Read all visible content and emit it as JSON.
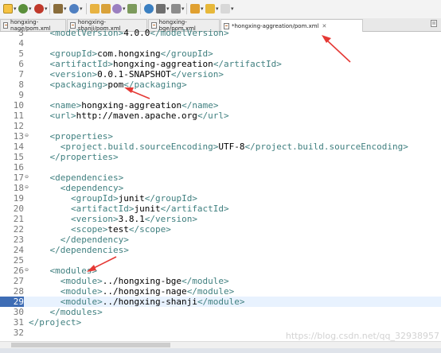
{
  "tabs": [
    {
      "label": "hongxing-nage/pom.xml",
      "close": "",
      "active": false
    },
    {
      "label": "hongxing-shanji/pom.xml",
      "close": "",
      "active": false
    },
    {
      "label": "hongxing-bge/pom.xml",
      "close": "",
      "active": false
    },
    {
      "label": "*hongxing-aggreation/pom.xml",
      "close": "✕",
      "active": true
    }
  ],
  "editor": {
    "current_line": "29",
    "lines": [
      {
        "n": "3",
        "fold": "",
        "parts": [
          {
            "t": "    <modelVersion>",
            "c": "tg"
          },
          {
            "t": "4.0.0",
            "c": "tx"
          },
          {
            "t": "</modelVersion>",
            "c": "tg"
          }
        ]
      },
      {
        "n": "4",
        "fold": "",
        "parts": []
      },
      {
        "n": "5",
        "fold": "",
        "parts": [
          {
            "t": "    <groupId>",
            "c": "tg"
          },
          {
            "t": "com.hongxing",
            "c": "tx"
          },
          {
            "t": "</groupId>",
            "c": "tg"
          }
        ]
      },
      {
        "n": "6",
        "fold": "",
        "parts": [
          {
            "t": "    <artifactId>",
            "c": "tg"
          },
          {
            "t": "hongxing-aggreation",
            "c": "tx"
          },
          {
            "t": "</artifactId>",
            "c": "tg"
          }
        ]
      },
      {
        "n": "7",
        "fold": "",
        "parts": [
          {
            "t": "    <version>",
            "c": "tg"
          },
          {
            "t": "0.0.1-SNAPSHOT",
            "c": "tx"
          },
          {
            "t": "</version>",
            "c": "tg"
          }
        ]
      },
      {
        "n": "8",
        "fold": "",
        "parts": [
          {
            "t": "    <packaging>",
            "c": "tg"
          },
          {
            "t": "pom",
            "c": "tx"
          },
          {
            "t": "</packaging>",
            "c": "tg"
          }
        ]
      },
      {
        "n": "9",
        "fold": "",
        "parts": []
      },
      {
        "n": "10",
        "fold": "",
        "parts": [
          {
            "t": "    <name>",
            "c": "tg"
          },
          {
            "t": "hongxing-aggreation",
            "c": "tx"
          },
          {
            "t": "</name>",
            "c": "tg"
          }
        ]
      },
      {
        "n": "11",
        "fold": "",
        "parts": [
          {
            "t": "    <url>",
            "c": "tg"
          },
          {
            "t": "http://maven.apache.org",
            "c": "tx"
          },
          {
            "t": "</url>",
            "c": "tg"
          }
        ]
      },
      {
        "n": "12",
        "fold": "",
        "parts": []
      },
      {
        "n": "13",
        "fold": "⊖",
        "parts": [
          {
            "t": "    <properties>",
            "c": "tg"
          }
        ]
      },
      {
        "n": "14",
        "fold": "",
        "parts": [
          {
            "t": "      <project.build.sourceEncoding>",
            "c": "tg"
          },
          {
            "t": "UTF-8",
            "c": "tx"
          },
          {
            "t": "</project.build.sourceEncoding>",
            "c": "tg"
          }
        ]
      },
      {
        "n": "15",
        "fold": "",
        "parts": [
          {
            "t": "    </properties>",
            "c": "tg"
          }
        ]
      },
      {
        "n": "16",
        "fold": "",
        "parts": []
      },
      {
        "n": "17",
        "fold": "⊖",
        "parts": [
          {
            "t": "    <dependencies>",
            "c": "tg"
          }
        ]
      },
      {
        "n": "18",
        "fold": "⊖",
        "parts": [
          {
            "t": "      <dependency>",
            "c": "tg"
          }
        ]
      },
      {
        "n": "19",
        "fold": "",
        "parts": [
          {
            "t": "        <groupId>",
            "c": "tg"
          },
          {
            "t": "junit",
            "c": "tx"
          },
          {
            "t": "</groupId>",
            "c": "tg"
          }
        ]
      },
      {
        "n": "20",
        "fold": "",
        "parts": [
          {
            "t": "        <artifactId>",
            "c": "tg"
          },
          {
            "t": "junit",
            "c": "tx"
          },
          {
            "t": "</artifactId>",
            "c": "tg"
          }
        ]
      },
      {
        "n": "21",
        "fold": "",
        "parts": [
          {
            "t": "        <version>",
            "c": "tg"
          },
          {
            "t": "3.8.1",
            "c": "tx"
          },
          {
            "t": "</version>",
            "c": "tg"
          }
        ]
      },
      {
        "n": "22",
        "fold": "",
        "parts": [
          {
            "t": "        <scope>",
            "c": "tg"
          },
          {
            "t": "test",
            "c": "tx"
          },
          {
            "t": "</scope>",
            "c": "tg"
          }
        ]
      },
      {
        "n": "23",
        "fold": "",
        "parts": [
          {
            "t": "      </dependency>",
            "c": "tg"
          }
        ]
      },
      {
        "n": "24",
        "fold": "",
        "parts": [
          {
            "t": "    </dependencies>",
            "c": "tg"
          }
        ]
      },
      {
        "n": "25",
        "fold": "",
        "parts": []
      },
      {
        "n": "26",
        "fold": "⊖",
        "parts": [
          {
            "t": "    <modules>",
            "c": "tg"
          }
        ]
      },
      {
        "n": "27",
        "fold": "",
        "parts": [
          {
            "t": "      <module>",
            "c": "tg"
          },
          {
            "t": "../hongxing-bge",
            "c": "tx"
          },
          {
            "t": "</module>",
            "c": "tg"
          }
        ]
      },
      {
        "n": "28",
        "fold": "",
        "parts": [
          {
            "t": "      <module>",
            "c": "tg"
          },
          {
            "t": "../hongxing-nage",
            "c": "tx"
          },
          {
            "t": "</module>",
            "c": "tg"
          }
        ]
      },
      {
        "n": "29",
        "fold": "",
        "parts": [
          {
            "t": "      <module>",
            "c": "tg"
          },
          {
            "t": "../hongxing-shanji",
            "c": "tx"
          },
          {
            "t": "</module>",
            "c": "tg"
          }
        ]
      },
      {
        "n": "30",
        "fold": "",
        "parts": [
          {
            "t": "    </modules>",
            "c": "tg"
          }
        ]
      },
      {
        "n": "31",
        "fold": "",
        "parts": [
          {
            "t": "</project>",
            "c": "tg"
          }
        ]
      },
      {
        "n": "32",
        "fold": "",
        "parts": []
      }
    ]
  },
  "watermark": "https://blog.csdn.net/qq_32938957",
  "colors": {
    "tag": "#3f7f7f",
    "text": "#000000",
    "annotation_arrow": "#e53935",
    "current_line_bg": "#e8f2fe"
  }
}
